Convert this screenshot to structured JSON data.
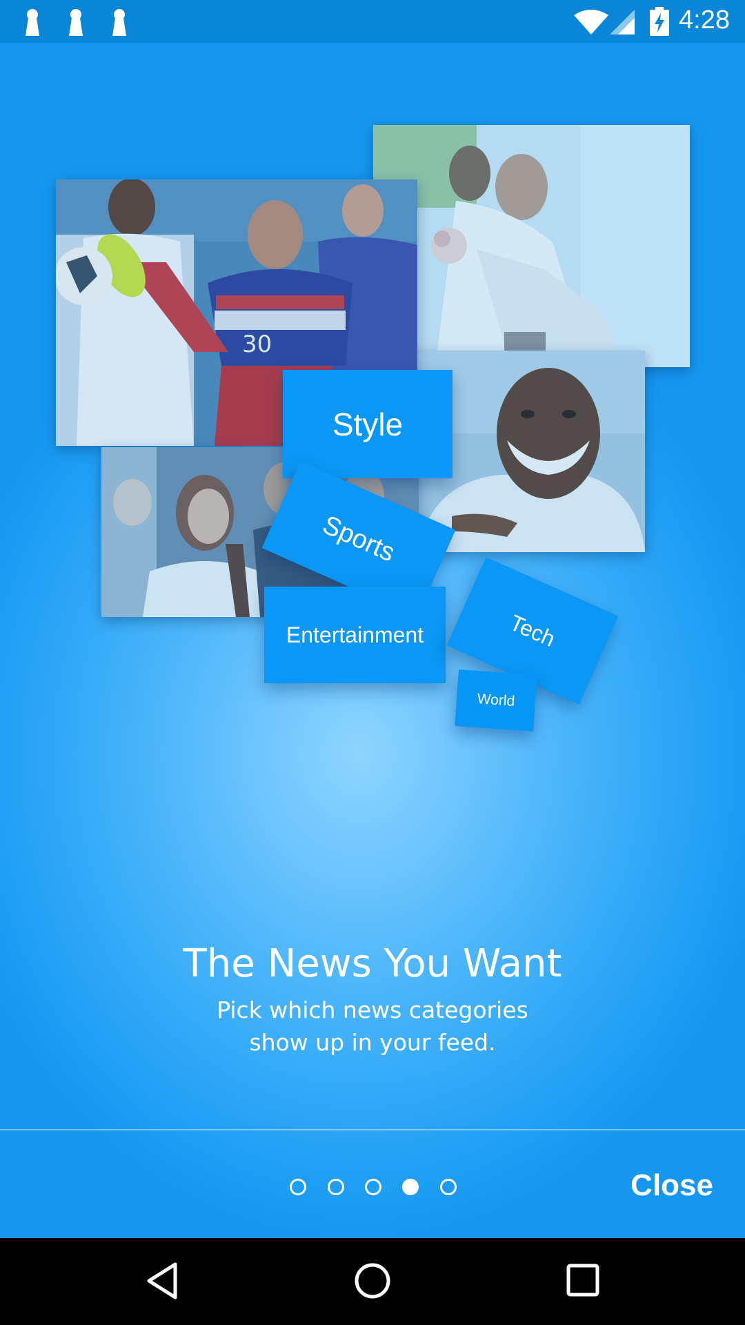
{
  "status_bar": {
    "time": "4:28",
    "icons": [
      "keyhole-icon",
      "keyhole-icon",
      "keyhole-icon",
      "wifi-icon",
      "signal-icon",
      "battery-charging-icon"
    ]
  },
  "onboarding": {
    "photos": [
      "soccer-player-photo",
      "wedding-couple-photo",
      "smiling-man-photo",
      "woman-in-crowd-photo"
    ],
    "categories": {
      "style": "Style",
      "sports": "Sports",
      "entertainment": "Entertainment",
      "tech": "Tech",
      "world": "World"
    },
    "title": "The News You Want",
    "subtitle_line1": "Pick which news categories",
    "subtitle_line2": "show up in your feed."
  },
  "pager": {
    "total": 5,
    "active_index": 4
  },
  "footer": {
    "close_label": "Close"
  },
  "nav_bar": {
    "icons": [
      "back-icon",
      "home-icon",
      "recents-icon"
    ]
  },
  "colors": {
    "status_bar": "#0a86d8",
    "background": "#1f9ff4",
    "tile": "#0a97f5",
    "text": "#ffffff"
  }
}
